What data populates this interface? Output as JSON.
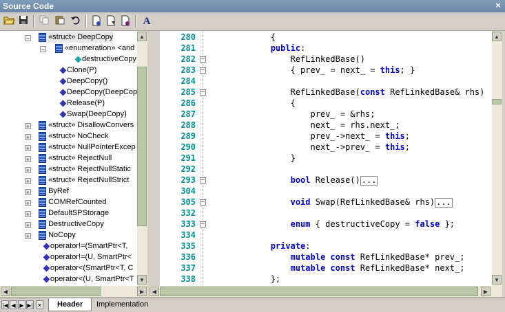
{
  "window": {
    "title": "Source Code",
    "close_glyph": "×"
  },
  "toolbar": {
    "icons": [
      "open-folder-icon",
      "save-icon",
      "copy-icon",
      "paste-icon",
      "undo-icon",
      "new-file-icon",
      "insert-file-icon",
      "delete-file-icon",
      "font-icon"
    ],
    "font_glyph": "A"
  },
  "tree": {
    "rows": [
      {
        "label": "«struct» DeepCopy"
      },
      {
        "label": "«enumeration» <and"
      },
      {
        "label": "destructiveCopy"
      },
      {
        "label": "Clone(P)"
      },
      {
        "label": "DeepCopy()"
      },
      {
        "label": "DeepCopy(DeepCop"
      },
      {
        "label": "Release(P)"
      },
      {
        "label": "Swap(DeepCopy)"
      },
      {
        "label": "«struct» DisallowConvers"
      },
      {
        "label": "«struct» NoCheck"
      },
      {
        "label": "«struct» NullPointerExcep"
      },
      {
        "label": "«struct» RejectNull"
      },
      {
        "label": "«struct» RejectNullStatic"
      },
      {
        "label": "«struct» RejectNullStrict"
      },
      {
        "label": "ByRef"
      },
      {
        "label": "COMRefCounted"
      },
      {
        "label": "DefaultSPStorage"
      },
      {
        "label": "DestructiveCopy"
      },
      {
        "label": "NoCopy"
      },
      {
        "label": "operator!=(SmartPtr<T,"
      },
      {
        "label": "operator!=(U, SmartPtr<"
      },
      {
        "label": "operator<(SmartPtr<T, C"
      },
      {
        "label": "operator<(U, SmartPtr<T"
      }
    ]
  },
  "code": {
    "lines": [
      {
        "n": "280",
        "t": "            {"
      },
      {
        "n": "281",
        "t": "            public:"
      },
      {
        "n": "282",
        "t": "                RefLinkedBase()"
      },
      {
        "n": "283",
        "t": "                { prev_ = next_ = this; }"
      },
      {
        "n": "284",
        "t": ""
      },
      {
        "n": "285",
        "t": "                RefLinkedBase(const RefLinkedBase& rhs)"
      },
      {
        "n": "286",
        "t": "                {"
      },
      {
        "n": "287",
        "t": "                    prev_ = &rhs;"
      },
      {
        "n": "288",
        "t": "                    next_ = rhs.next_;"
      },
      {
        "n": "289",
        "t": "                    prev_->next_ = this;"
      },
      {
        "n": "290",
        "t": "                    next_->prev_ = this;"
      },
      {
        "n": "291",
        "t": "                }"
      },
      {
        "n": "292",
        "t": ""
      },
      {
        "n": "293",
        "t": "                bool Release()"
      },
      {
        "n": "304",
        "t": ""
      },
      {
        "n": "305",
        "t": "                void Swap(RefLinkedBase& rhs)"
      },
      {
        "n": "332",
        "t": ""
      },
      {
        "n": "333",
        "t": "                enum { destructiveCopy = false };"
      },
      {
        "n": "334",
        "t": ""
      },
      {
        "n": "335",
        "t": "            private:"
      },
      {
        "n": "336",
        "t": "                mutable const RefLinkedBase* prev_;"
      },
      {
        "n": "337",
        "t": "                mutable const RefLinkedBase* next_;"
      },
      {
        "n": "338",
        "t": "            };"
      }
    ],
    "fold_marker": "..."
  },
  "tabs": {
    "items": [
      "Header",
      "Implementation"
    ],
    "nav": [
      "|◀",
      "◀",
      "▶",
      "▶|",
      "✕"
    ]
  }
}
